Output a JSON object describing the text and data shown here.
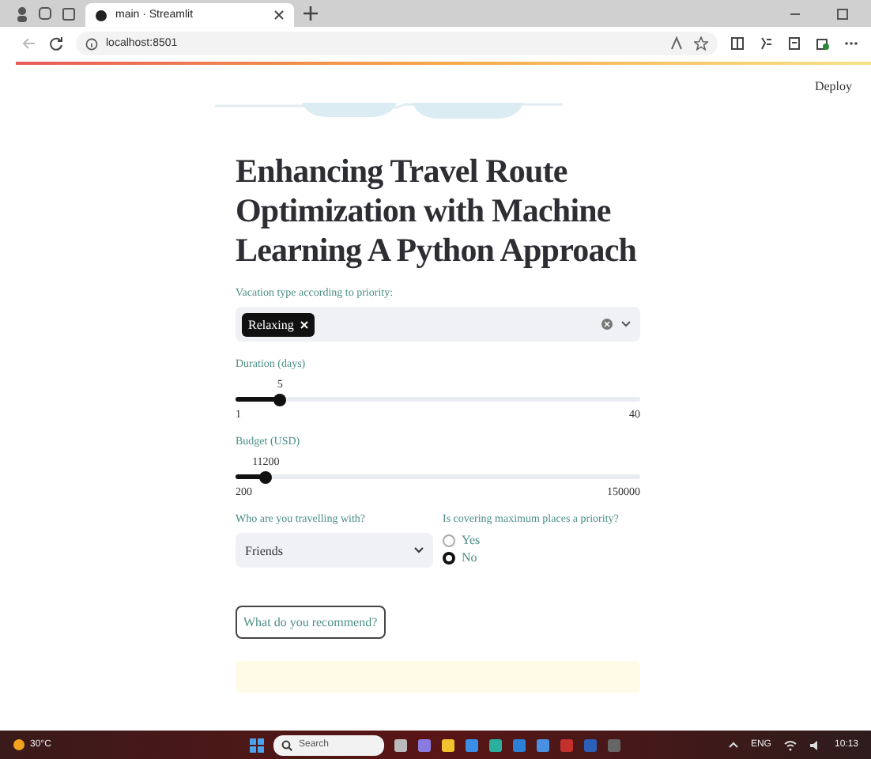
{
  "browser": {
    "tab_title": "main · Streamlit",
    "address": "localhost:8501"
  },
  "header": {
    "deploy": "Deploy"
  },
  "title": "Enhancing Travel Route Optimization with Machine Learning A Python Approach",
  "vacation": {
    "label": "Vacation type according to priority:",
    "chips": [
      "Relaxing"
    ]
  },
  "sliders": [
    {
      "label": "Duration (days)",
      "value": "5",
      "min": "1",
      "max": "40",
      "level": 0.11
    },
    {
      "label": "Budget (USD)",
      "value": "11200",
      "min": "200",
      "max": "150000",
      "level": 0.075
    }
  ],
  "companion": {
    "label": "Who are you travelling with?",
    "value": "Friends"
  },
  "priority": {
    "label": "Is covering maximum places a priority?",
    "options": [
      {
        "label": "Yes",
        "selected": false
      },
      {
        "label": "No",
        "selected": true
      }
    ]
  },
  "button": "What do you recommend?",
  "taskbar": {
    "weather": "30°C",
    "search_placeholder": "Search",
    "language": "ENG",
    "time": "10:13"
  }
}
